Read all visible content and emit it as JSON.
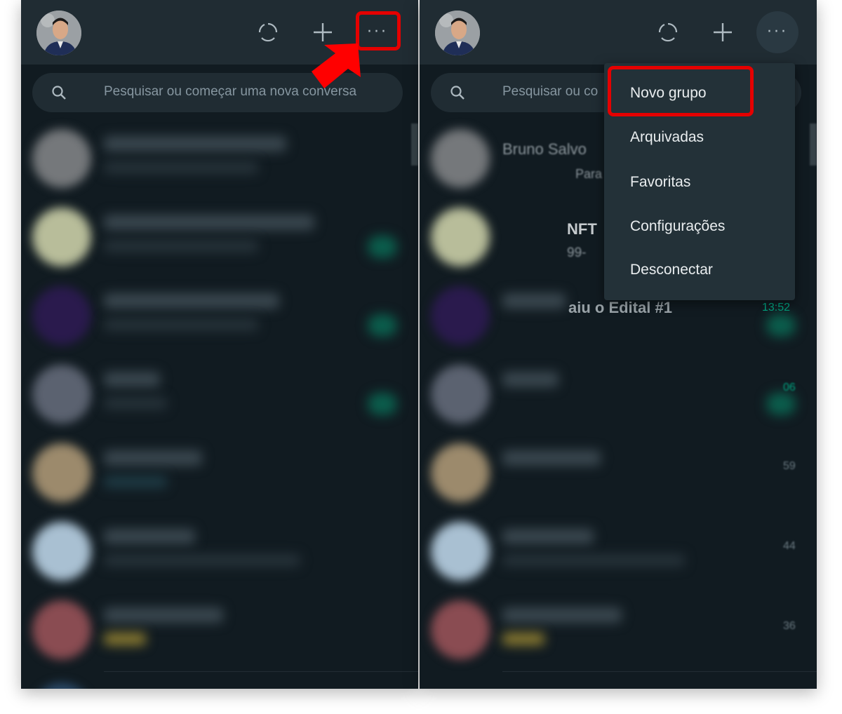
{
  "left_panel": {
    "search": {
      "placeholder": "Pesquisar ou começar uma nova conversa"
    },
    "header_icons": [
      "status-icon",
      "new-chat-icon",
      "menu-dots-icon"
    ],
    "menu_dots": "···"
  },
  "right_panel": {
    "search": {
      "placeholder": "Pesquisar ou co"
    },
    "menu_dots": "···",
    "visible_chat_text": {
      "name1": "Bruno Salvo",
      "msg1": "Para",
      "name2": "NFT",
      "msg2": "99-",
      "name3": "aiu o Edital #1",
      "time3": "13:52",
      "time4": "06",
      "time5": "59",
      "time6": "44",
      "time7": "36"
    }
  },
  "dropdown_menu": {
    "items": [
      {
        "label": "Novo grupo",
        "highlighted": true
      },
      {
        "label": "Arquivadas"
      },
      {
        "label": "Favoritas"
      },
      {
        "label": "Configurações"
      },
      {
        "label": "Desconectar"
      }
    ]
  },
  "annotations": {
    "highlight_color": "#e50000",
    "arrow_color": "#ff0000"
  },
  "colors": {
    "background": "#111b21",
    "header": "#202c33",
    "menu_bg": "#233138",
    "accent": "#00a884"
  }
}
